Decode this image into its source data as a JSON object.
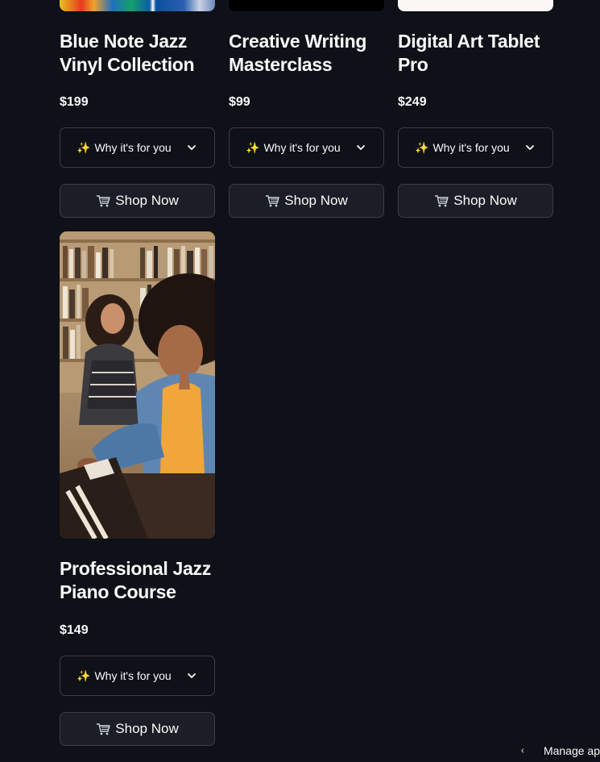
{
  "products": [
    {
      "title": "Blue Note Jazz Vinyl Collection",
      "title_lines": [
        "Blue Note Jazz",
        "Vinyl Collection"
      ],
      "price": "$199",
      "why_label": "Why it's for you",
      "shop_label": "Shop Now",
      "image": "colorful-album-cover"
    },
    {
      "title": "Creative Writing Masterclass",
      "title_lines": [
        "Creative Writing",
        "Masterclass"
      ],
      "price": "$99",
      "why_label": "Why it's for you",
      "shop_label": "Shop Now",
      "image": "dark-image"
    },
    {
      "title": "Digital Art Tablet Pro",
      "title_lines": [
        "Digital Art Tablet",
        "Pro"
      ],
      "price": "$249",
      "why_label": "Why it's for you",
      "shop_label": "Shop Now",
      "image": "light-image"
    },
    {
      "title": "Professional Jazz Piano Course",
      "title_lines": [
        "Professional Jazz",
        "Piano Course"
      ],
      "price": "$149",
      "why_label": "Why it's for you",
      "shop_label": "Shop Now",
      "image": "women-playing-piano-in-library-photo"
    }
  ],
  "footer": {
    "manage_label": "Manage ap"
  },
  "icons": {
    "sparkle": "sparkles-icon",
    "chevron": "chevron-down-icon",
    "cart": "shopping-cart-icon",
    "back": "chevron-left-icon"
  },
  "colors": {
    "background": "#0e1117",
    "text": "#fafafa",
    "border": "#3a3d46",
    "button_bg": "#1b1e26",
    "sparkle": "#f5c542"
  }
}
